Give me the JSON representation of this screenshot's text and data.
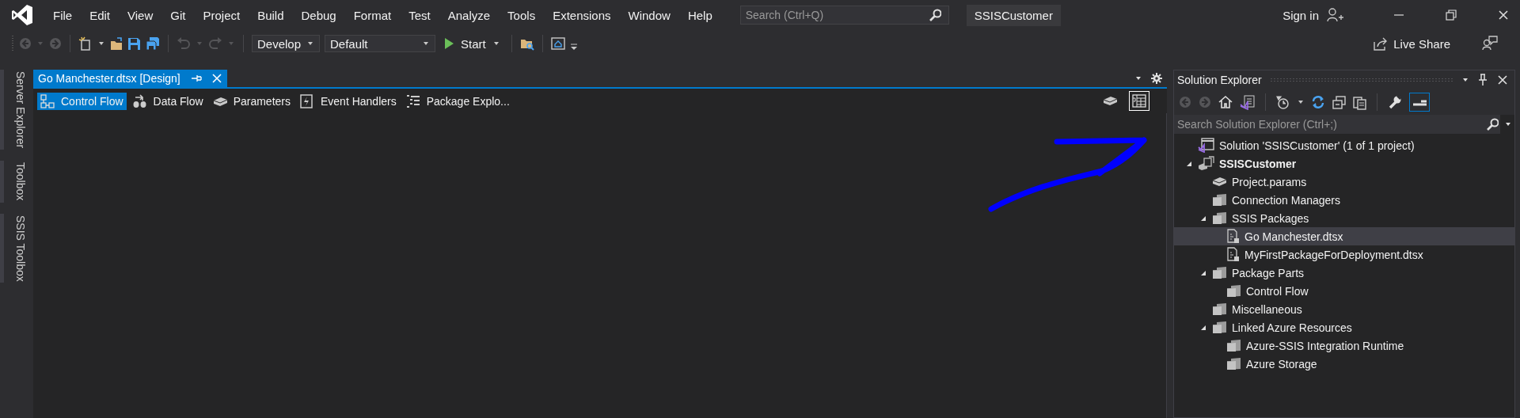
{
  "menu_bar": {
    "items": [
      "File",
      "Edit",
      "View",
      "Git",
      "Project",
      "Build",
      "Debug",
      "Format",
      "Test",
      "Analyze",
      "Tools",
      "Extensions",
      "Window",
      "Help"
    ],
    "search": {
      "placeholder": "Search (Ctrl+Q)"
    },
    "solution_name": "SSISCustomer",
    "sign_in": "Sign in"
  },
  "toolbar": {
    "back": {
      "disabled": true
    },
    "forward": {
      "disabled": true
    },
    "undo": {
      "disabled": true
    },
    "redo": {
      "disabled": true
    },
    "configuration": "Develop",
    "platform": "Default",
    "start": "Start",
    "live_share": "Live Share"
  },
  "side_tabs": [
    "Server Explorer",
    "Toolbox",
    "SSIS Toolbox"
  ],
  "document_tab": {
    "title": "Go Manchester.dtsx [Design]",
    "selected": true
  },
  "designer_tabs": [
    {
      "label": "Control Flow",
      "selected": true
    },
    {
      "label": "Data Flow",
      "selected": false
    },
    {
      "label": "Parameters",
      "selected": false
    },
    {
      "label": "Event Handlers",
      "selected": false
    },
    {
      "label": "Package Explo...",
      "selected": false
    }
  ],
  "designer_view_buttons": [
    {
      "selected": false
    },
    {
      "selected": true
    }
  ],
  "annotation": {
    "kind": "arrow"
  },
  "solution_explorer": {
    "title": "Solution Explorer",
    "toolbar": {
      "back": {
        "disabled": true
      },
      "forward": {
        "disabled": true
      },
      "preview_selected": {
        "on": true
      }
    },
    "search": {
      "placeholder": "Search Solution Explorer (Ctrl+;)"
    },
    "tree": [
      {
        "label": "Solution 'SSISCustomer' (1 of 1 project)",
        "kind": "solution",
        "bold": false,
        "selected": false,
        "expanded": false
      },
      {
        "label": "SSISCustomer",
        "kind": "project",
        "bold": true,
        "selected": false,
        "expanded": true,
        "children": [
          {
            "label": "Project.params",
            "kind": "params",
            "bold": false,
            "selected": false,
            "expanded": false
          },
          {
            "label": "Connection Managers",
            "kind": "folder",
            "bold": false,
            "selected": false,
            "expanded": false
          },
          {
            "label": "SSIS Packages",
            "kind": "folder",
            "bold": false,
            "selected": false,
            "expanded": true,
            "children": [
              {
                "label": "Go Manchester.dtsx",
                "kind": "package",
                "bold": false,
                "selected": true,
                "expanded": false
              },
              {
                "label": "MyFirstPackageForDeployment.dtsx",
                "kind": "package",
                "bold": false,
                "selected": false,
                "expanded": false
              }
            ]
          },
          {
            "label": "Package Parts",
            "kind": "folder",
            "bold": false,
            "selected": false,
            "expanded": true,
            "children": [
              {
                "label": "Control Flow",
                "kind": "folder",
                "bold": false,
                "selected": false,
                "expanded": false
              }
            ]
          },
          {
            "label": "Miscellaneous",
            "kind": "folder",
            "bold": false,
            "selected": false,
            "expanded": false
          },
          {
            "label": "Linked Azure Resources",
            "kind": "folder",
            "bold": false,
            "selected": false,
            "expanded": true,
            "children": [
              {
                "label": "Azure-SSIS Integration Runtime",
                "kind": "folder",
                "bold": false,
                "selected": false,
                "expanded": false
              },
              {
                "label": "Azure Storage",
                "kind": "folder",
                "bold": false,
                "selected": false,
                "expanded": false
              }
            ]
          }
        ]
      }
    ]
  }
}
